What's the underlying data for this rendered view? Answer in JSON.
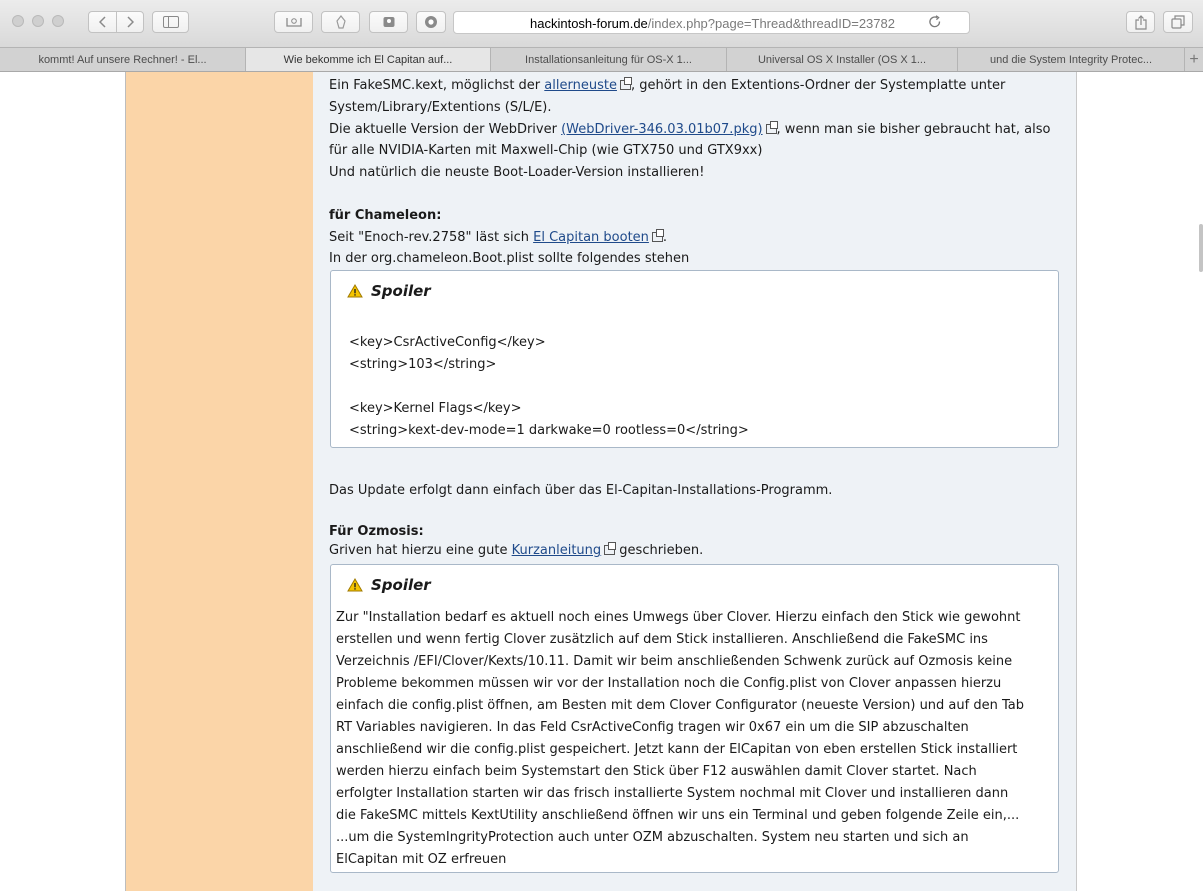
{
  "browser": {
    "url_host": "hackintosh-forum.de",
    "url_path": "/index.php?page=Thread&threadID=23782",
    "tabs": [
      {
        "label": "kommt! Auf unsere Rechner! - El..."
      },
      {
        "label": "Wie bekomme ich El Capitan auf..."
      },
      {
        "label": "Installationsanleitung für OS-X 1..."
      },
      {
        "label": "Universal OS X Installer (OS X 1..."
      },
      {
        "label": "und die System Integrity Protec..."
      }
    ],
    "new_tab_glyph": "+"
  },
  "post": {
    "p1_a": "Ein FakeSMC.kext, möglichst der ",
    "p1_link": "allerneuste",
    "p1_b": ", gehört in den Extentions-Ordner der Systemplatte unter",
    "p2": "System/Library/Extentions (S/L/E).",
    "p3_a": "Die aktuelle Version der WebDriver ",
    "p3_link": "(WebDriver-346.03.01b07.pkg)",
    "p3_b": ", wenn man sie bisher gebraucht hat, also",
    "p4": "für alle NVIDIA-Karten mit Maxwell-Chip (wie GTX750 und GTX9xx)",
    "p5": "Und natürlich die neuste Boot-Loader-Version installieren!",
    "chameleon_heading": "für Chameleon:",
    "ch1_a": "Seit \"Enoch-rev.2758\" läst sich ",
    "ch1_link": "El Capitan booten",
    "ch1_b": ".",
    "ch2": "In der org.chameleon.Boot.plist sollte folgendes stehen",
    "update_line": "Das Update erfolgt dann einfach über das El-Capitan-Installations-Programm.",
    "ozmosis_heading": "Für Ozmosis:",
    "oz1_a": "Griven hat hierzu eine gute ",
    "oz1_link": "Kurzanleitung",
    "oz1_b": " geschrieben."
  },
  "spoiler1": {
    "title": "Spoiler",
    "lines": [
      "<key>CsrActiveConfig</key>",
      "<string>103</string>",
      "<key>Kernel Flags</key>",
      "<string>kext-dev-mode=1 darkwake=0 rootless=0</string>"
    ]
  },
  "spoiler2": {
    "title": "Spoiler",
    "lines": [
      "Zur \"Installation bedarf es aktuell noch eines Umwegs über Clover. Hierzu einfach den Stick wie gewohnt",
      "erstellen und wenn fertig Clover zusätzlich auf dem Stick installieren. Anschließend die FakeSMC ins",
      "Verzeichnis /EFI/Clover/Kexts/10.11. Damit wir beim anschließenden Schwenk zurück auf Ozmosis keine",
      "Probleme bekommen müssen wir vor der Installation noch die Config.plist von Clover anpassen hierzu",
      "einfach die config.plist öffnen, am Besten mit dem Clover Configurator (neueste Version) und auf den Tab",
      "RT Variables navigieren. In das Feld CsrActiveConfig tragen wir 0x67 ein um die SIP abzuschalten",
      "anschließend wir die config.plist gespeichert. Jetzt kann der ElCapitan von eben erstellen Stick installiert",
      "werden hierzu einfach beim Systemstart den Stick über F12 auswählen damit Clover startet. Nach",
      "erfolgter Installation starten wir das frisch installierte System nochmal mit Clover und installieren dann",
      "die FakeSMC mittels KextUtility anschließend öffnen wir uns ein Terminal und geben folgende Zeile ein,...",
      "...um die SystemIngrityProtection auch unter OZM abzuschalten. System neu starten und sich an",
      "ElCapitan mit OZ erfreuen"
    ]
  },
  "colors": {
    "sidebar": "#fbd5a8",
    "content_bg": "#eef2f6",
    "link": "#1f4a8a",
    "warning": "#f5c400"
  },
  "icons": [
    "back-icon",
    "forward-icon",
    "sidebar-icon",
    "reading-list-icon",
    "ad-block-icon",
    "password-icon",
    "extension-icon",
    "reload-icon",
    "share-icon",
    "tabs-overview-icon",
    "warning-icon",
    "external-link-icon"
  ]
}
